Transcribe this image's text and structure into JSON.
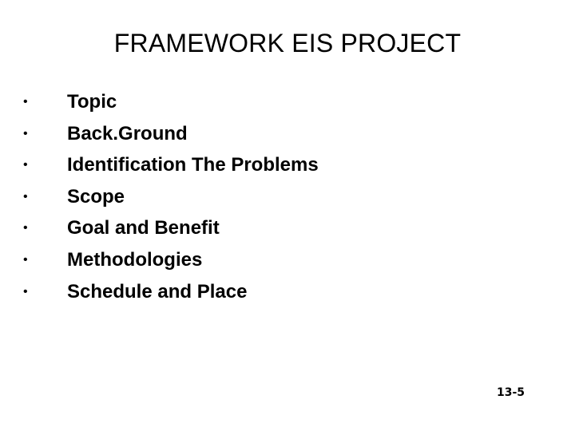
{
  "slide": {
    "title": "FRAMEWORK EIS PROJECT",
    "bullet_symbol": "•",
    "items": [
      {
        "label": "Topic"
      },
      {
        "label": "Back.Ground"
      },
      {
        "label": "Identification The Problems"
      },
      {
        "label": "Scope"
      },
      {
        "label": "Goal and Benefit"
      },
      {
        "label": "Methodologies"
      },
      {
        "label": "Schedule and Place"
      }
    ],
    "slide_number": "13-5"
  }
}
